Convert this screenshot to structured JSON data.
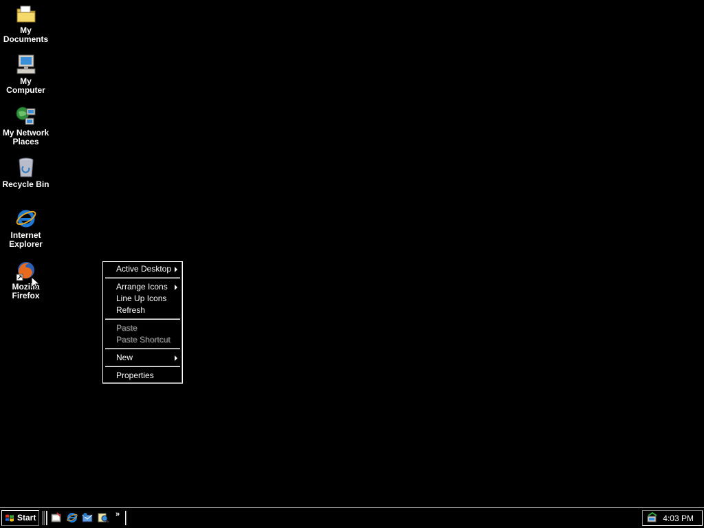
{
  "desktop": {
    "background": "#000000",
    "icons": [
      {
        "label": "My\nDocuments"
      },
      {
        "label": "My\nComputer"
      },
      {
        "label": "My Network\nPlaces"
      },
      {
        "label": "Recycle Bin"
      },
      {
        "label": "Internet\nExplorer"
      },
      {
        "label": "Mozilla\nFirefox"
      }
    ]
  },
  "context_menu": {
    "items": [
      {
        "label": "Active Desktop",
        "submenu": true,
        "enabled": true
      },
      {
        "label": "Arrange Icons",
        "submenu": true,
        "enabled": true
      },
      {
        "label": "Line Up Icons",
        "submenu": false,
        "enabled": true
      },
      {
        "label": "Refresh",
        "submenu": false,
        "enabled": true
      },
      {
        "label": "Paste",
        "submenu": false,
        "enabled": false
      },
      {
        "label": "Paste Shortcut",
        "submenu": false,
        "enabled": false
      },
      {
        "label": "New",
        "submenu": true,
        "enabled": true
      },
      {
        "label": "Properties",
        "submenu": false,
        "enabled": true
      }
    ]
  },
  "taskbar": {
    "start_label": "Start",
    "quick_launch": [
      "show-desktop-icon",
      "internet-explorer-icon",
      "outlook-express-icon",
      "windows-media-icon"
    ],
    "more_label": "»",
    "clock": "4:03 PM"
  }
}
